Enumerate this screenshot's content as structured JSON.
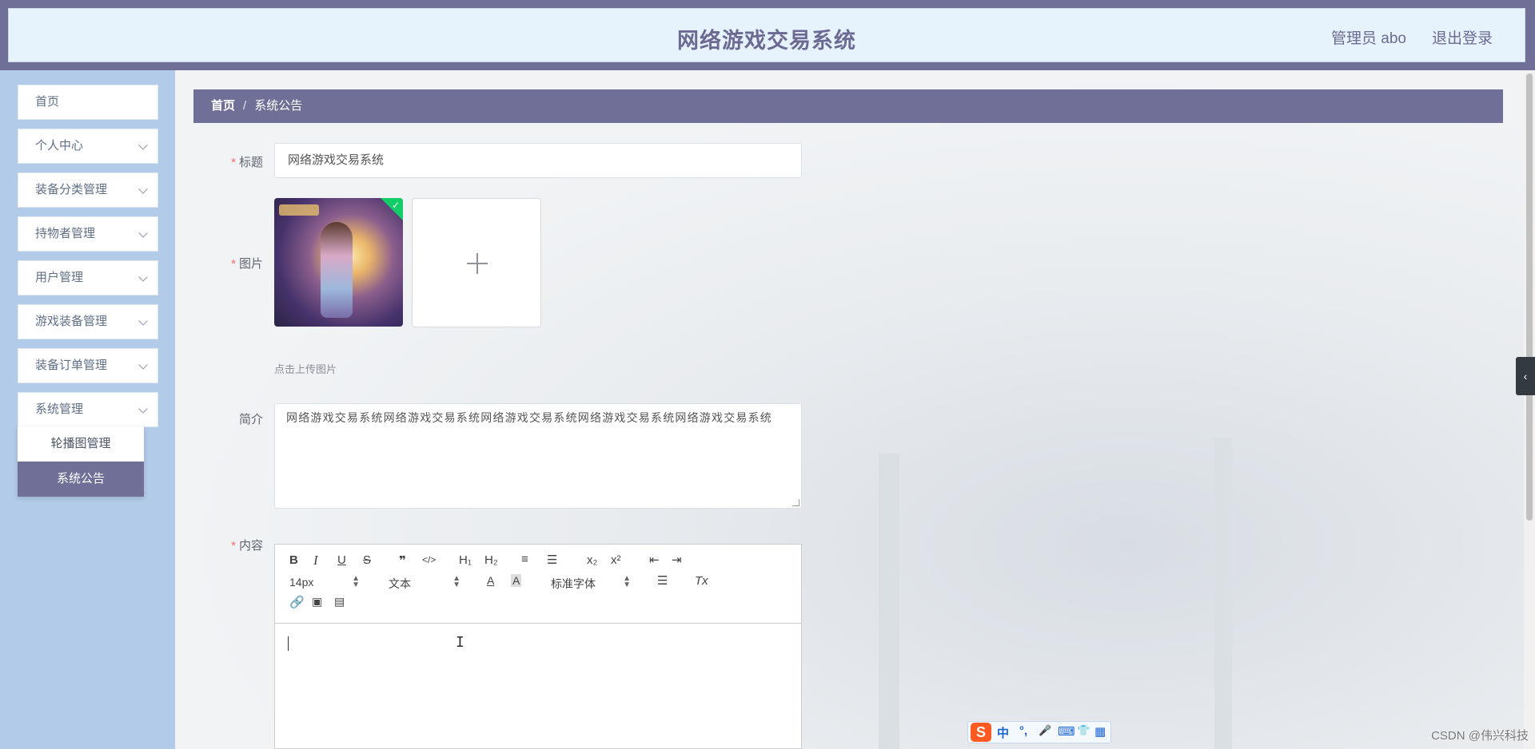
{
  "header": {
    "title": "网络游戏交易系统",
    "user_label": "管理员 abo",
    "logout_label": "退出登录"
  },
  "sidebar": {
    "items": [
      {
        "label": "首页"
      },
      {
        "label": "个人中心"
      },
      {
        "label": "装备分类管理"
      },
      {
        "label": "持物者管理"
      },
      {
        "label": "用户管理"
      },
      {
        "label": "游戏装备管理"
      },
      {
        "label": "装备订单管理"
      },
      {
        "label": "系统管理"
      }
    ],
    "submenu": [
      {
        "label": "轮播图管理",
        "active": false
      },
      {
        "label": "系统公告",
        "active": true
      }
    ]
  },
  "breadcrumb": {
    "home": "首页",
    "separator": "/",
    "current": "系统公告"
  },
  "form": {
    "title_label": "标题",
    "title_value": "网络游戏交易系统",
    "image_label": "图片",
    "upload_hint": "点击上传图片",
    "intro_label": "简介",
    "intro_value": "网络游戏交易系统网络游戏交易系统网络游戏交易系统网络游戏交易系统网络游戏交易系统",
    "content_label": "内容",
    "required_mark": "*"
  },
  "editor": {
    "toolbar_row1": [
      "B",
      "I",
      "U",
      "S",
      "❞",
      "</>",
      "H₁",
      "H₂",
      "≡",
      "☰",
      "x₂",
      "x²",
      "⇤",
      "⇥"
    ],
    "font_size": "14px",
    "text_style": "文本",
    "font_family": "标准字体",
    "clean_icon": "Tx"
  },
  "ime": {
    "logo": "S",
    "items": [
      "中",
      "°,",
      "🎤",
      "⌨",
      "👕",
      "▦"
    ]
  },
  "watermark": "CSDN @伟兴科技"
}
